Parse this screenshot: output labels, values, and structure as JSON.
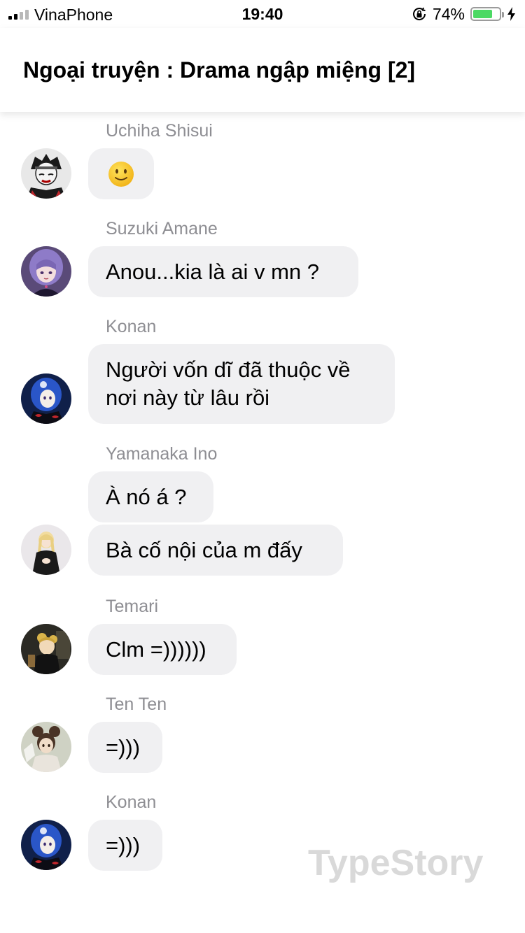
{
  "status_bar": {
    "carrier": "VinaPhone",
    "time": "19:40",
    "battery_percent": "74%",
    "battery_level": 0.74,
    "battery_color": "#4cd964",
    "signal_bars": 2,
    "icons": [
      "signal-icon",
      "orientation-lock-icon",
      "battery-icon",
      "charging-bolt-icon"
    ]
  },
  "header": {
    "title": "Ngoại truyện : Drama ngập miệng [2]"
  },
  "messages": [
    {
      "sender": "Uchiha Shisui",
      "text": "",
      "emoji": "slightly-smiling-face-icon"
    },
    {
      "sender": "Suzuki Amane",
      "text": "Anou...kia là ai v mn ?"
    },
    {
      "sender": "Konan",
      "text_lines": [
        "Người vốn dĩ đã thuộc về",
        "nơi này từ lâu rồi"
      ]
    },
    {
      "sender": "Yamanaka Ino",
      "texts": [
        "À nó á ?",
        "Bà cố nội của m đấy"
      ]
    },
    {
      "sender": "Temari",
      "text": "Clm =))))))"
    },
    {
      "sender": "Ten Ten",
      "text": "=)))"
    },
    {
      "sender": "Konan",
      "text": "=)))"
    }
  ],
  "watermark": "TypeStory",
  "colors": {
    "bubble": "#f0f0f2",
    "sender_name": "#8e8e93",
    "watermark": "#d9d9d9"
  }
}
